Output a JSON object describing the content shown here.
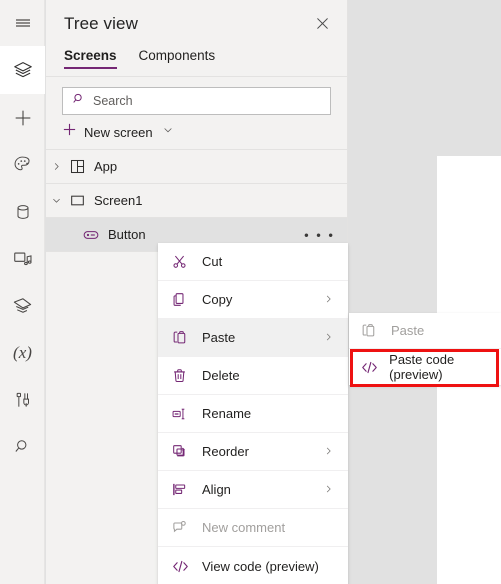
{
  "rail": {
    "items": [
      {
        "name": "hamburger-menu-icon",
        "label": "Menu",
        "selected": false
      },
      {
        "name": "tree-view-layers-icon",
        "label": "Tree view",
        "selected": true
      },
      {
        "name": "insert-plus-icon",
        "label": "Insert",
        "selected": false
      },
      {
        "name": "theme-palette-icon",
        "label": "Theme",
        "selected": false
      },
      {
        "name": "data-database-icon",
        "label": "Data",
        "selected": false
      },
      {
        "name": "media-icon",
        "label": "Media",
        "selected": false
      },
      {
        "name": "power-automate-flows-icon",
        "label": "Power Automate",
        "selected": false
      },
      {
        "name": "variables-x-icon",
        "label": "Variables",
        "selected": false
      },
      {
        "name": "advanced-tools-icon",
        "label": "Advanced tools",
        "selected": false
      },
      {
        "name": "search-rail-icon",
        "label": "Search",
        "selected": false
      }
    ]
  },
  "panel": {
    "title": "Tree view",
    "close_label": "✕",
    "tabs": [
      {
        "label": "Screens",
        "active": true
      },
      {
        "label": "Components",
        "active": false
      }
    ],
    "search": {
      "placeholder": "Search",
      "value": ""
    },
    "new_screen": {
      "label": "New screen",
      "plus": "+",
      "chevron": "∨"
    },
    "tree": [
      {
        "label": "App",
        "expanded": false,
        "chevron": "›",
        "icon": "app-grid-icon",
        "indent": 0,
        "selected": false,
        "has_ellipsis": false
      },
      {
        "label": "Screen1",
        "expanded": true,
        "chevron": "∨",
        "icon": "screen-rect-icon",
        "indent": 0,
        "selected": false,
        "has_ellipsis": false
      },
      {
        "label": "Button",
        "expanded": false,
        "chevron": "",
        "icon": "button-control-icon",
        "indent": 1,
        "selected": true,
        "has_ellipsis": true,
        "ellipsis": "• • •"
      }
    ]
  },
  "context_menu": {
    "items": [
      {
        "label": "Cut",
        "icon": "scissors-icon",
        "submenu": false,
        "disabled": false,
        "hover": false
      },
      {
        "label": "Copy",
        "icon": "copy-icon",
        "submenu": true,
        "disabled": false,
        "hover": false
      },
      {
        "label": "Paste",
        "icon": "paste-clipboard-icon",
        "submenu": true,
        "disabled": false,
        "hover": true
      },
      {
        "label": "Delete",
        "icon": "trash-icon",
        "submenu": false,
        "disabled": false,
        "hover": false
      },
      {
        "label": "Rename",
        "icon": "rename-icon",
        "submenu": false,
        "disabled": false,
        "hover": false
      },
      {
        "label": "Reorder",
        "icon": "reorder-icon",
        "submenu": true,
        "disabled": false,
        "hover": false
      },
      {
        "label": "Align",
        "icon": "align-icon",
        "submenu": true,
        "disabled": false,
        "hover": false
      },
      {
        "label": "New comment",
        "icon": "comment-icon",
        "submenu": false,
        "disabled": true,
        "hover": false
      },
      {
        "label": "View code (preview)",
        "icon": "code-brackets-icon",
        "submenu": false,
        "disabled": false,
        "hover": false
      }
    ],
    "submenu_chevron": "›"
  },
  "sub_menu": {
    "items": [
      {
        "label": "Paste",
        "icon": "paste-clipboard-icon",
        "disabled": true,
        "highlighted": false
      },
      {
        "label": "Paste code (preview)",
        "icon": "code-brackets-icon",
        "disabled": false,
        "highlighted": true
      }
    ]
  },
  "colors": {
    "accent_purple": "#742774",
    "panel_bg": "#f3f2f1",
    "canvas_bg": "#e1e1e1",
    "highlight_red": "#ee1111",
    "selected_row": "#e1e1e1"
  }
}
